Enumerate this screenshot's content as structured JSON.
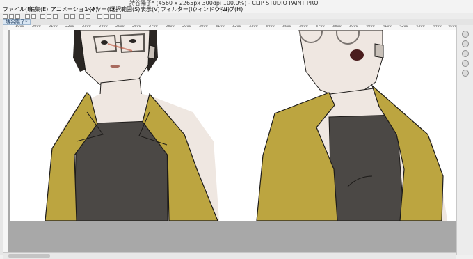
{
  "window": {
    "title": "詩谷陽子* (4560 x 2265px 300dpi 100.0%) - CLIP STUDIO PAINT PRO"
  },
  "menu": [
    {
      "label": "ファイル(F)"
    },
    {
      "label": "編集(E)"
    },
    {
      "label": "アニメーション(A)"
    },
    {
      "label": "レイヤー(L)"
    },
    {
      "label": "選択範囲(S)"
    },
    {
      "label": "表示(V)"
    },
    {
      "label": "フィルター(I)"
    },
    {
      "label": "ウィンドウ(W)"
    },
    {
      "label": "ヘルプ(H)"
    }
  ],
  "tab": {
    "label": "詩谷陽子*"
  },
  "ruler": {
    "labels": [
      "1900",
      "2000",
      "2100",
      "2200",
      "2300",
      "2400",
      "2500",
      "2600",
      "2700",
      "2800",
      "2900",
      "3000",
      "3100",
      "3200",
      "3300",
      "3400",
      "3500",
      "3600",
      "3700",
      "3800",
      "3900",
      "4000",
      "4100",
      "4200",
      "4300",
      "4400",
      "4500"
    ]
  },
  "colors": {
    "jacket": "#bca540",
    "shirt": "#4b4845",
    "skin": "#f1ede8",
    "line": "#1d1b19"
  }
}
